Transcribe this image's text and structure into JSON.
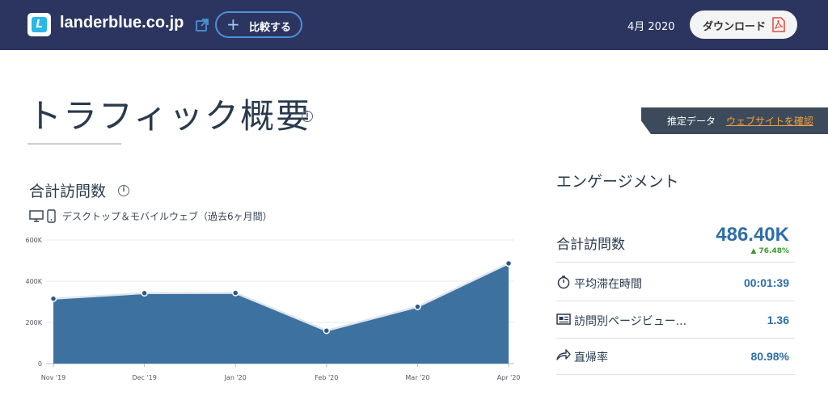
{
  "header": {
    "domain": "landerblue.co.jp",
    "compare_label": "比較する",
    "date": "4月 2020",
    "download_label": "ダウンロード",
    "colors": {
      "bar": "#2b3560",
      "accent": "#4d92d9"
    }
  },
  "page": {
    "title": "トラフィック概要",
    "info_glyph": "i"
  },
  "banner": {
    "label": "推定データ",
    "link": "ウェブサイトを確認"
  },
  "visits": {
    "title": "合計訪問数",
    "device_label": "デスクトップ＆モバイルウェブ（過去6ヶ月間）"
  },
  "chart_data": {
    "type": "area",
    "categories": [
      "Nov '19",
      "Dec '19",
      "Jan '20",
      "Feb '20",
      "Mar '20",
      "Apr '20"
    ],
    "values": [
      315000,
      342000,
      343000,
      160000,
      276000,
      486400
    ],
    "ylim": [
      0,
      600000
    ],
    "yticks": [
      0,
      200000,
      400000,
      600000
    ],
    "ytick_labels": [
      "0",
      "200K",
      "400K",
      "600K"
    ],
    "grid": true,
    "color": "#3d72a0"
  },
  "engagement": {
    "title": "エンゲージメント",
    "total_label": "合計訪問数",
    "total_value": "486.40K",
    "total_change": "76.48%",
    "rows": [
      {
        "label": "平均滞在時間",
        "value": "00:01:39",
        "icon": "stopwatch-icon"
      },
      {
        "label": "訪問別ページビュー...",
        "value": "1.36",
        "icon": "pages-icon"
      },
      {
        "label": "直帰率",
        "value": "80.98%",
        "icon": "bounce-arrow-icon"
      }
    ]
  }
}
